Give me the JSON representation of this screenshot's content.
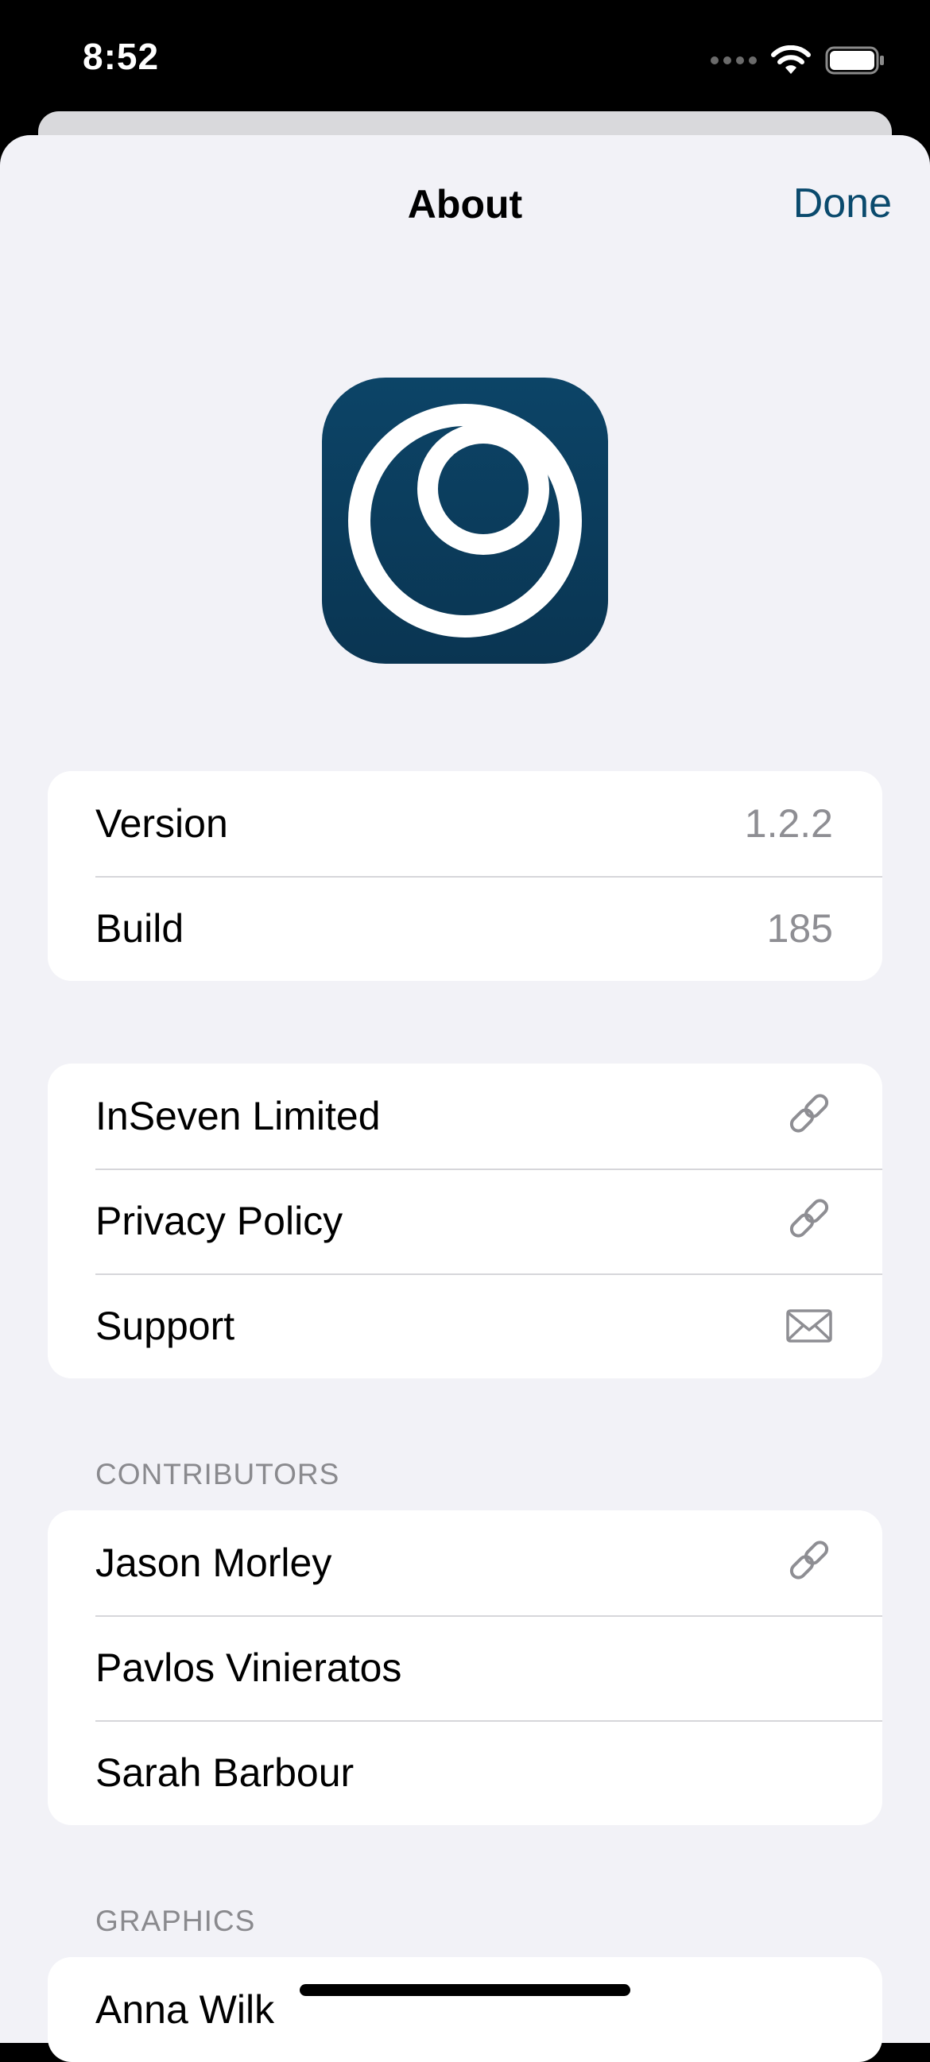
{
  "status_bar": {
    "time": "8:52"
  },
  "nav": {
    "title": "About",
    "done_label": "Done"
  },
  "info_group": [
    {
      "label": "Version",
      "value": "1.2.2"
    },
    {
      "label": "Build",
      "value": "185"
    }
  ],
  "links_group": [
    {
      "label": "InSeven Limited",
      "icon": "link-icon"
    },
    {
      "label": "Privacy Policy",
      "icon": "link-icon"
    },
    {
      "label": "Support",
      "icon": "envelope-icon"
    }
  ],
  "contributors": {
    "header": "CONTRIBUTORS",
    "items": [
      {
        "name": "Jason Morley",
        "icon": "link-icon"
      },
      {
        "name": "Pavlos Vinieratos"
      },
      {
        "name": "Sarah Barbour"
      }
    ]
  },
  "graphics": {
    "header": "GRAPHICS",
    "items": [
      {
        "name": "Anna Wilk"
      }
    ]
  },
  "colors": {
    "accent": "#0a4a6d",
    "icon_bg_top": "#0c4467",
    "icon_bg_bottom": "#0a3552",
    "background": "#f2f2f7"
  }
}
